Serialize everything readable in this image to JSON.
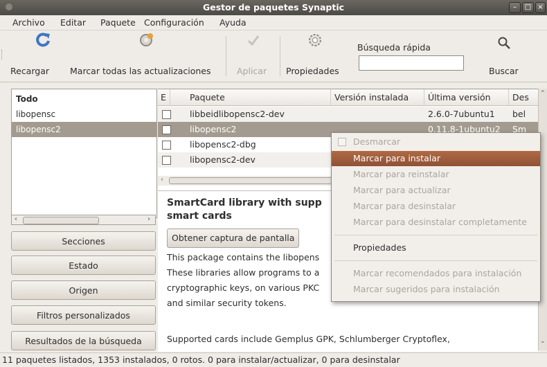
{
  "window": {
    "title": "Gestor de paquetes Synaptic"
  },
  "menubar": [
    "Archivo",
    "Editar",
    "Paquete",
    "Configuración",
    "Ayuda"
  ],
  "toolbar": {
    "reload": "Recargar",
    "mark_all": "Marcar todas las actualizaciones",
    "apply": "Aplicar",
    "properties": "Propiedades",
    "quick_search_label": "Búsqueda rápida",
    "quick_search_value": "",
    "search": "Buscar"
  },
  "filters": [
    "Todo",
    "libopensc",
    "libopensc2"
  ],
  "side_buttons": [
    "Secciones",
    "Estado",
    "Origen",
    "Filtros personalizados",
    "Resultados de la búsqueda"
  ],
  "table": {
    "columns": [
      "E",
      "Paquete",
      "Versión instalada",
      "Última versión",
      "Des"
    ],
    "rows": [
      {
        "name": "libbeidlibopensc2-dev",
        "installed": "",
        "latest": "2.6.0-7ubuntu1",
        "desc": "bel"
      },
      {
        "name": "libopensc2",
        "installed": "",
        "latest": "0.11.8-1ubuntu2",
        "desc": "Sm"
      },
      {
        "name": "libopensc2-dbg",
        "installed": "",
        "latest": "",
        "desc": ""
      },
      {
        "name": "libopensc2-dev",
        "installed": "",
        "latest": "",
        "desc": ""
      }
    ]
  },
  "description": {
    "title": "SmartCard library with supp smart cards",
    "screenshot_button": "Obtener captura de pantalla",
    "lines": [
      "This package contains the libopens",
      " These libraries allow programs to a",
      "cryptographic keys, on various PKC",
      "and similar security tokens.",
      "",
      "Supported cards include Gemplus GPK, Schlumberger Cryptoflex,"
    ]
  },
  "context_menu": {
    "items": [
      {
        "label": "Desmarcar",
        "enabled": false
      },
      {
        "label": "Marcar para instalar",
        "enabled": true,
        "highlighted": true
      },
      {
        "label": "Marcar para reinstalar",
        "enabled": false
      },
      {
        "label": "Marcar para actualizar",
        "enabled": false
      },
      {
        "label": "Marcar para desinstalar",
        "enabled": false
      },
      {
        "label": "Marcar para desinstalar completamente",
        "enabled": false
      },
      {
        "label": "Propiedades",
        "enabled": true
      },
      {
        "label": "Marcar recomendados para instalación",
        "enabled": false
      },
      {
        "label": "Marcar sugeridos para instalación",
        "enabled": false
      }
    ]
  },
  "status": "11 paquetes listados, 1353 instalados, 0 rotos. 0 para instalar/actualizar, 0 para desinstalar",
  "colors": {
    "highlight": "#a0522d",
    "selection": "#a39b8f",
    "window_bg": "#efebe7"
  }
}
